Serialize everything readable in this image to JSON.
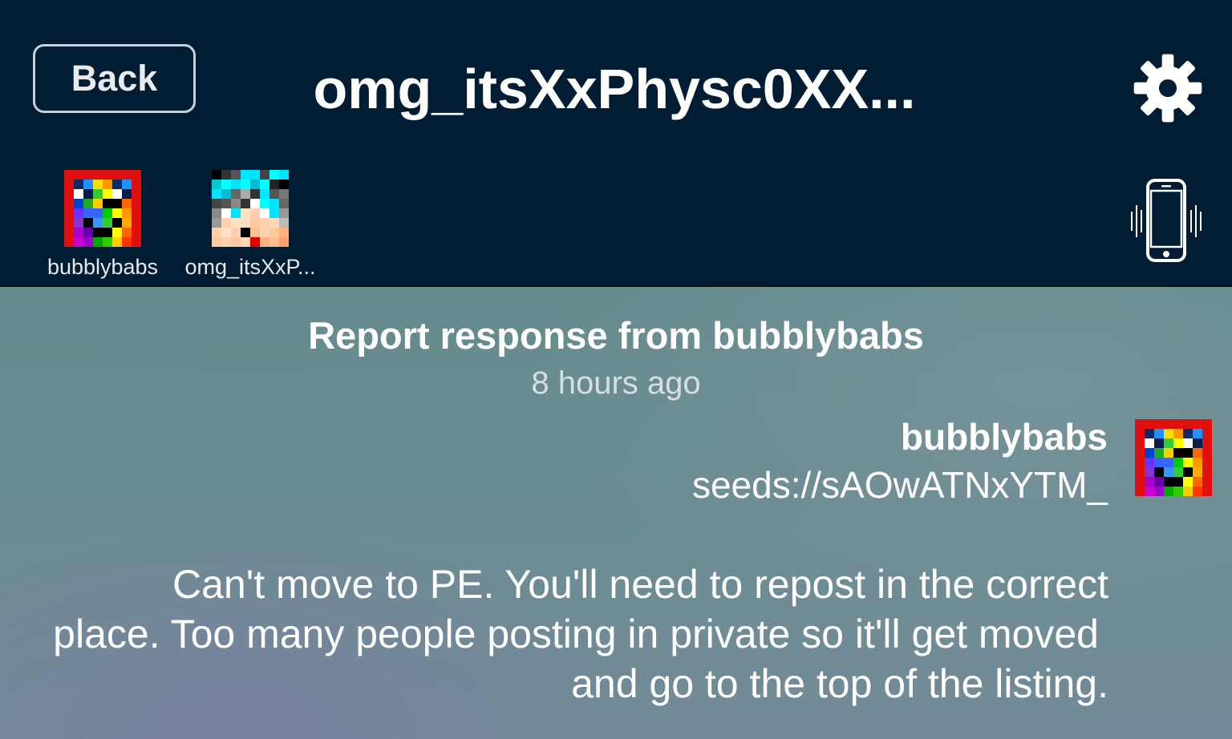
{
  "header": {
    "back_label": "Back",
    "title": "omg_itsXxPhysc0XX...",
    "participants": [
      {
        "name": "bubblybabs",
        "avatar": "rainbow-pixel-avatar"
      },
      {
        "name": "omg_itsXxP...",
        "avatar": "cyan-hair-pixel-avatar"
      }
    ],
    "settings_icon": "gear-icon",
    "vibrate_icon": "phone-vibrate-icon"
  },
  "report": {
    "title": "Report response from bubblybabs",
    "time": "8 hours ago",
    "author": "bubblybabs",
    "seed": "seeds://sAOwATNxYTM_",
    "message_lines": [
      "Can't move to PE.  You'll need to repost in the correct",
      "place.  Too many people posting in private so it'll get moved",
      "and go to the top of the listing."
    ]
  },
  "colors": {
    "header_bg": "#011d33",
    "content_bg": "#6a8c91",
    "text": "#ffffff"
  }
}
